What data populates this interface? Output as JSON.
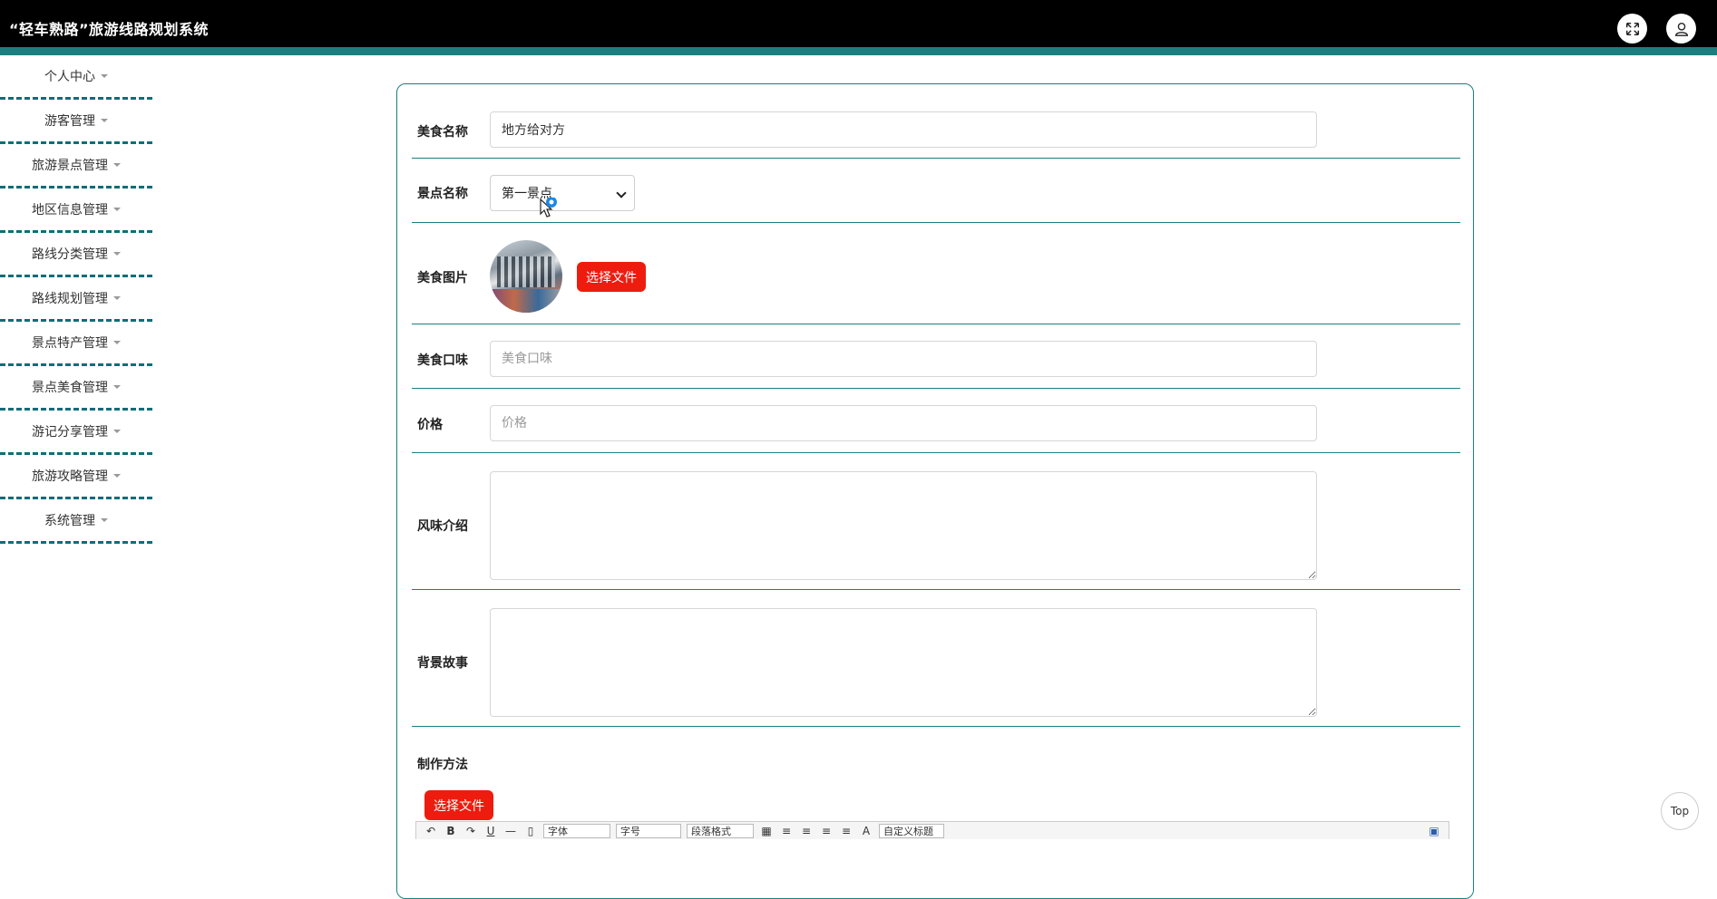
{
  "header": {
    "title": "“轻车熟路”旅游线路规划系统",
    "fullscreen_icon": "expand-icon",
    "user_icon": "user-icon"
  },
  "sidebar": {
    "items": [
      {
        "label": "个人中心"
      },
      {
        "label": "游客管理"
      },
      {
        "label": "旅游景点管理"
      },
      {
        "label": "地区信息管理"
      },
      {
        "label": "路线分类管理"
      },
      {
        "label": "路线规划管理"
      },
      {
        "label": "景点特产管理"
      },
      {
        "label": "景点美食管理"
      },
      {
        "label": "游记分享管理"
      },
      {
        "label": "旅游攻略管理"
      },
      {
        "label": "系统管理"
      }
    ]
  },
  "form": {
    "food_name": {
      "label": "美食名称",
      "value": "地方给对方"
    },
    "spot_name": {
      "label": "景点名称",
      "value": "第一景点"
    },
    "food_image": {
      "label": "美食图片",
      "button": "选择文件"
    },
    "taste": {
      "label": "美食口味",
      "placeholder": "美食口味"
    },
    "price": {
      "label": "价格",
      "placeholder": "价格"
    },
    "flavor_intro": {
      "label": "风味介绍"
    },
    "background_story": {
      "label": "背景故事"
    },
    "method": {
      "label": "制作方法",
      "button": "选择文件"
    }
  },
  "editor_toolbar": {
    "font": "字体",
    "size": "字号",
    "paragraph": "段落格式",
    "custom_title": "自定义标题"
  },
  "back_to_top": "Top"
}
